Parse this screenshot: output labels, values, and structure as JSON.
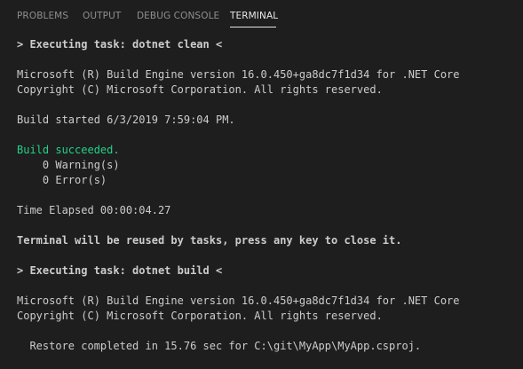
{
  "tabs": {
    "problems": "PROBLEMS",
    "output": "OUTPUT",
    "debug_console": "DEBUG CONSOLE",
    "terminal": "TERMINAL"
  },
  "terminal": {
    "lines": [
      "> Executing task: dotnet clean <",
      "Microsoft (R) Build Engine version 16.0.450+ga8dc7f1d34 for .NET Core",
      "Copyright (C) Microsoft Corporation. All rights reserved.",
      "Build started 6/3/2019 7:59:04 PM.",
      "Build succeeded.",
      "    0 Warning(s)",
      "    0 Error(s)",
      "Time Elapsed 00:00:04.27",
      "Terminal will be reused by tasks, press any key to close it.",
      "> Executing task: dotnet build <",
      "Microsoft (R) Build Engine version 16.0.450+ga8dc7f1d34 for .NET Core",
      "Copyright (C) Microsoft Corporation. All rights reserved.",
      "  Restore completed in 15.76 sec for C:\\git\\MyApp\\MyApp.csproj."
    ],
    "colors": {
      "background": "#1e1e1e",
      "text": "#cccccc",
      "success": "#23d18b"
    }
  }
}
